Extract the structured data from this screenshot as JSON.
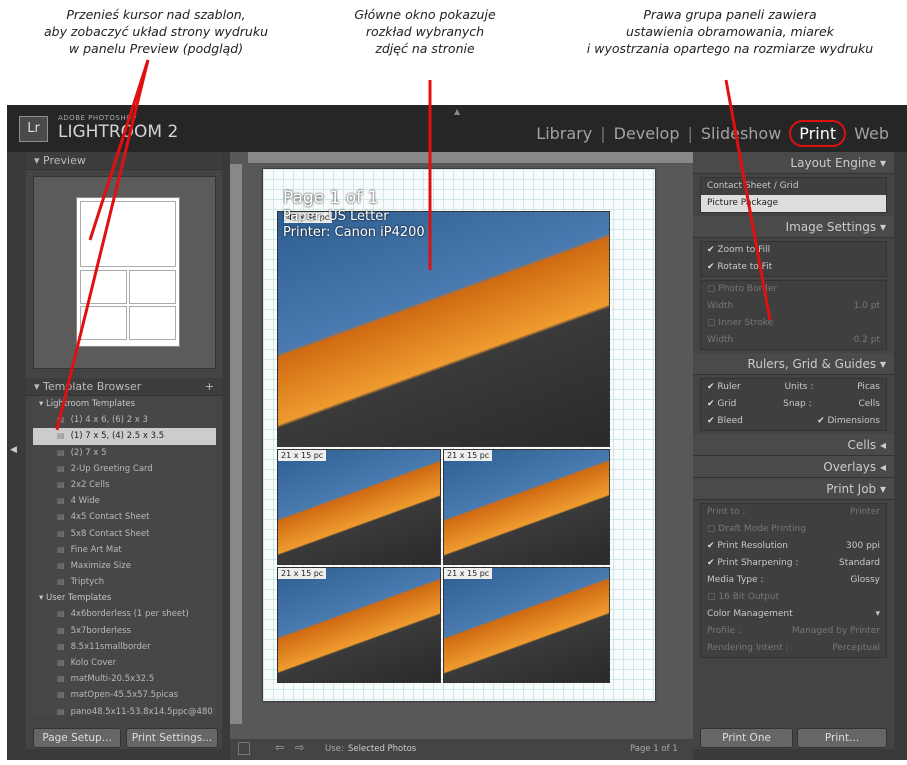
{
  "annotations": [
    "Przenieś kursor nad szablon,\naby zobaczyć układ strony wydruku\nw panelu Preview (podgląd)",
    "Główne okno pokazuje\nrozkład wybranych\nzdjęć na stronie",
    "Prawa grupa paneli zawiera\nustawienia obramowania, miarek\ni wyostrzania opartego na rozmiarze wydruku"
  ],
  "app": {
    "logo": "Lr",
    "brand_small": "ADOBE PHOTOSHOP",
    "brand_main": "LIGHTROOM 2",
    "modules": [
      "Library",
      "Develop",
      "Slideshow",
      "Print",
      "Web"
    ],
    "active_module": "Print"
  },
  "left": {
    "preview_title": "Preview",
    "template_browser_title": "Template Browser",
    "templates": [
      {
        "label": "Lightroom Templates",
        "type": "folder"
      },
      {
        "label": "(1) 4 x 6, (6) 2 x 3",
        "type": "tpl"
      },
      {
        "label": "(1) 7 x 5, (4) 2.5 x 3.5",
        "type": "tpl",
        "selected": true
      },
      {
        "label": "(2) 7 x 5",
        "type": "tpl"
      },
      {
        "label": "2-Up Greeting Card",
        "type": "tpl"
      },
      {
        "label": "2x2 Cells",
        "type": "tpl"
      },
      {
        "label": "4 Wide",
        "type": "tpl"
      },
      {
        "label": "4x5 Contact Sheet",
        "type": "tpl"
      },
      {
        "label": "5x8 Contact Sheet",
        "type": "tpl"
      },
      {
        "label": "Fine Art Mat",
        "type": "tpl"
      },
      {
        "label": "Maximize Size",
        "type": "tpl"
      },
      {
        "label": "Triptych",
        "type": "tpl"
      },
      {
        "label": "User Templates",
        "type": "folder"
      },
      {
        "label": "4x6borderless (1 per sheet)",
        "type": "tpl"
      },
      {
        "label": "5x7borderless",
        "type": "tpl"
      },
      {
        "label": "8.5x11smallborder",
        "type": "tpl"
      },
      {
        "label": "Kolo Cover",
        "type": "tpl"
      },
      {
        "label": "matMulti-20.5x32.5",
        "type": "tpl"
      },
      {
        "label": "matOpen-45.5x57.5picas",
        "type": "tpl"
      },
      {
        "label": "pano48.5x11-53.8x14.5ppc@480",
        "type": "tpl"
      }
    ],
    "page_setup_btn": "Page Setup...",
    "print_settings_btn": "Print Settings..."
  },
  "center": {
    "page_title": "Page 1 of 1",
    "paper": "Paper: US Letter",
    "printer": "Printer: Canon iP4200",
    "big_label": "42 x 36 pc",
    "small_label": "21 x 15 pc",
    "use_label": "Use:",
    "use_value": "Selected Photos",
    "page_counter": "Page 1 of 1"
  },
  "right": {
    "layout_engine_title": "Layout Engine",
    "layout_engine_options": [
      "Contact Sheet / Grid",
      "Picture Package"
    ],
    "image_settings_title": "Image Settings",
    "zoom_to_fill": "Zoom to Fill",
    "rotate_to_fit": "Rotate to Fit",
    "photo_border": "Photo Border",
    "width_label": "Width",
    "photo_border_width": "1.0 pt",
    "inner_stroke": "Inner Stroke",
    "inner_stroke_width": "0.2 pt",
    "rulers_title": "Rulers, Grid & Guides",
    "ruler": "Ruler",
    "units_label": "Units :",
    "units_value": "Picas",
    "grid": "Grid",
    "snap_label": "Snap :",
    "snap_value": "Cells",
    "bleed": "Bleed",
    "dimensions": "Dimensions",
    "cells_title": "Cells",
    "overlays_title": "Overlays",
    "print_job_title": "Print Job",
    "print_to_label": "Print to :",
    "print_to_value": "Printer",
    "draft_mode": "Draft Mode Printing",
    "print_resolution": "Print Resolution",
    "resolution_value": "300",
    "resolution_unit": "ppi",
    "print_sharpening": "Print Sharpening :",
    "sharpening_value": "Standard",
    "media_type_label": "Media Type :",
    "media_type_value": "Glossy",
    "bit16": "16 Bit Output",
    "color_mgmt": "Color Management",
    "profile_label": "Profile :",
    "profile_value": "Managed by Printer",
    "intent_label": "Rendering Intent :",
    "intent_value": "Perceptual",
    "print_one_btn": "Print One",
    "print_btn": "Print..."
  }
}
